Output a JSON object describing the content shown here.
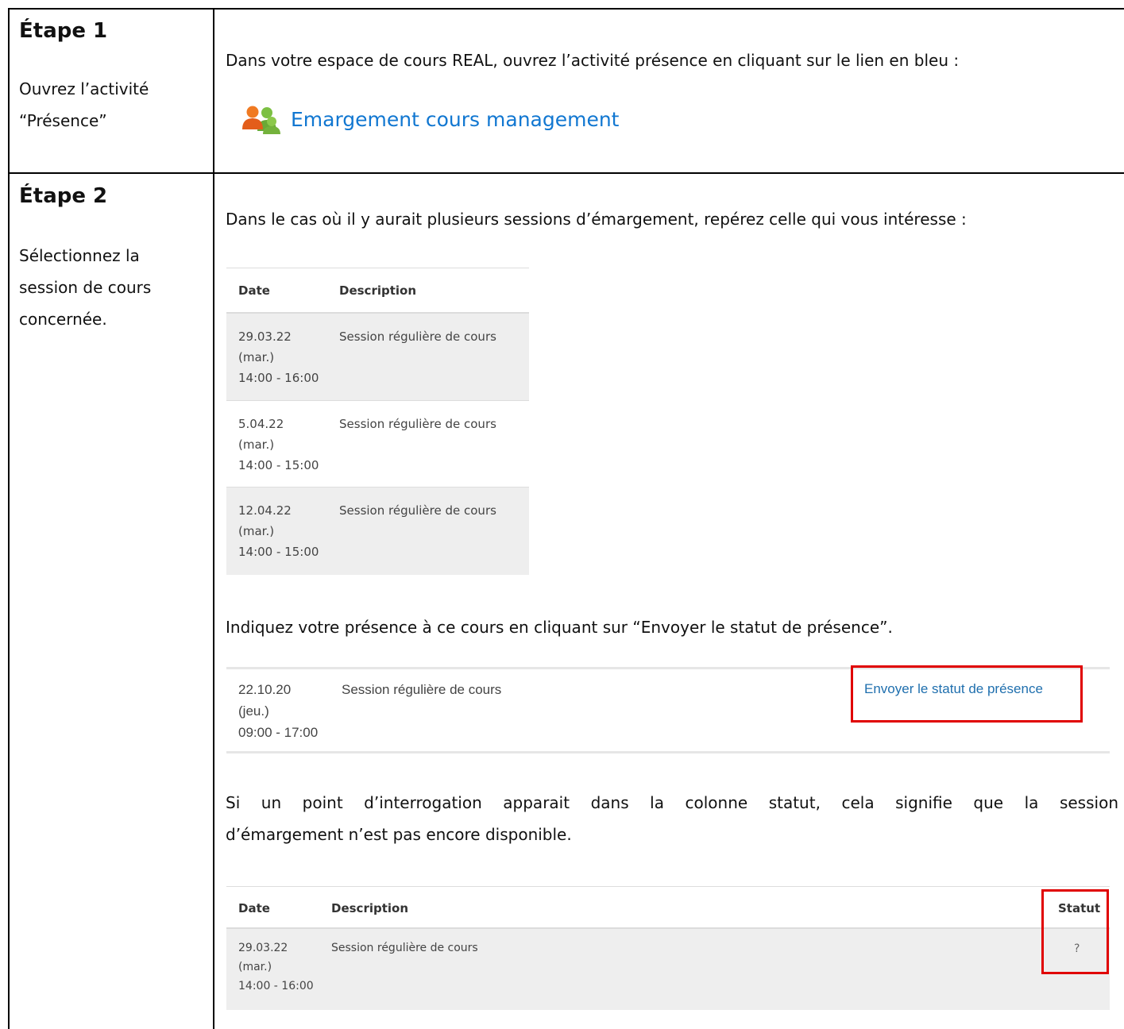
{
  "step1": {
    "title": "Étape 1",
    "desc": "Ouvrez l’activité “Présence”",
    "instruction": "Dans votre espace de cours REAL, ouvrez l’activité présence en cliquant sur le lien en bleu :",
    "link_text": "Emargement cours management",
    "link_icon": "users-group-icon"
  },
  "step2": {
    "title": "Étape 2",
    "desc": "Sélectionnez la session de cours concernée.",
    "instruction1": "Dans le cas où il y aurait plusieurs sessions d’émargement, repérez celle qui vous intéresse :",
    "table1": {
      "headers": [
        "Date",
        "Description"
      ],
      "rows": [
        {
          "date": "29.03.22\n(mar.)\n14:00 - 16:00",
          "desc": "Session régulière de cours"
        },
        {
          "date": "5.04.22\n(mar.)\n14:00 - 15:00",
          "desc": "Session régulière de cours"
        },
        {
          "date": "12.04.22\n(mar.)\n14:00 - 15:00",
          "desc": "Session régulière de cours"
        }
      ]
    },
    "instruction2": "Indiquez votre présence à ce cours en cliquant sur “Envoyer le statut de présence”.",
    "table2": {
      "row": {
        "date": "22.10.20\n(jeu.)\n09:00 - 17:00",
        "desc": "Session régulière de cours"
      },
      "action": "Envoyer le statut de présence"
    },
    "instruction3_line1": "Si un point d’interrogation apparait dans la colonne statut, cela signifie que la session",
    "instruction3_line2": "d’émargement n’est pas encore disponible.",
    "table3": {
      "headers": [
        "Date",
        "Description",
        "Statut"
      ],
      "row": {
        "date": "29.03.22\n(mar.)\n14:00 - 16:00",
        "desc": "Session régulière de cours",
        "status": "?"
      }
    }
  },
  "colors": {
    "link": "#1177d1",
    "highlight": "#e00000",
    "row_shaded": "#eeeeee"
  }
}
